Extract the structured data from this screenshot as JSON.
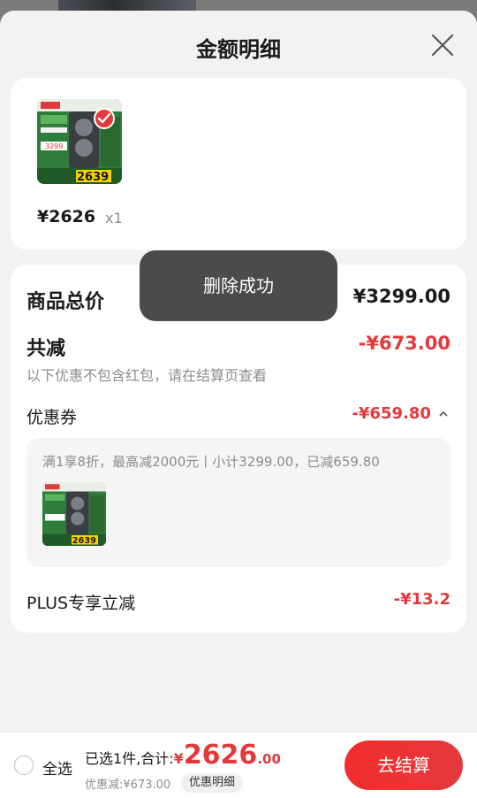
{
  "sheet": {
    "title": "金额明细",
    "close_icon": "close-icon"
  },
  "product": {
    "thumb_price_label": "2639",
    "thumb_sub_label": "3299",
    "price": "¥2626",
    "qty": "x1"
  },
  "detail": {
    "total_label": "商品总价",
    "total_value": "¥3299.00",
    "reduce_label": "共减",
    "reduce_value": "-¥673.00",
    "reduce_note": "以下优惠不包含红包，请在结算页查看",
    "coupon_label": "优惠券",
    "coupon_value": "-¥659.80",
    "coupon_desc": "满1享8折，最高减2000元丨小计3299.00，已减659.80",
    "plus_label": "PLUS专享立减",
    "plus_value": "-¥13.2"
  },
  "toast": {
    "text": "删除成功"
  },
  "bottom": {
    "select_all": "全选",
    "summary_prefix": "已选1件,合计:",
    "currency": "¥",
    "total_int": "2626",
    "total_dec": ".00",
    "discount_text": "优惠减:¥673.00",
    "detail_chip": "优惠明细",
    "checkout": "去结算"
  },
  "colors": {
    "accent_red": "#e4393c",
    "toast_bg": "#3c3c3c",
    "sheet_bg": "#f2f2f2"
  }
}
